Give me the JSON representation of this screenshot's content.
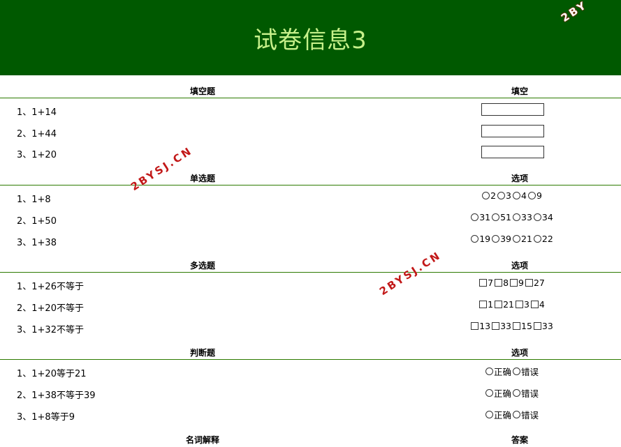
{
  "page": {
    "title": "试卷信息3"
  },
  "watermark": {
    "text": "2BYSJ.CN",
    "corner_text": "2BY"
  },
  "sections": [
    {
      "id": "fill",
      "head_left": "填空题",
      "head_right": "填空",
      "rows": [
        {
          "q": "1、1+14"
        },
        {
          "q": "2、1+44"
        },
        {
          "q": "3、1+20"
        }
      ]
    },
    {
      "id": "single",
      "head_left": "单选题",
      "head_right": "选项",
      "rows": [
        {
          "q": "1、1+8",
          "opts": [
            "2",
            "3",
            "4",
            "9"
          ]
        },
        {
          "q": "2、1+50",
          "opts": [
            "31",
            "51",
            "33",
            "34"
          ]
        },
        {
          "q": "3、1+38",
          "opts": [
            "19",
            "39",
            "21",
            "22"
          ]
        }
      ]
    },
    {
      "id": "multi",
      "head_left": "多选题",
      "head_right": "选项",
      "rows": [
        {
          "q": "1、1+26不等于",
          "opts": [
            "7",
            "8",
            "9",
            "27"
          ]
        },
        {
          "q": "2、1+20不等于",
          "opts": [
            "1",
            "21",
            "3",
            "4"
          ]
        },
        {
          "q": "3、1+32不等于",
          "opts": [
            "13",
            "33",
            "15",
            "33"
          ]
        }
      ]
    },
    {
      "id": "judge",
      "head_left": "判断题",
      "head_right": "选项",
      "rows": [
        {
          "q": "1、1+20等于21",
          "opts": [
            "正确",
            "错误"
          ]
        },
        {
          "q": "2、1+38不等于39",
          "opts": [
            "正确",
            "错误"
          ]
        },
        {
          "q": "3、1+8等于9",
          "opts": [
            "正确",
            "错误"
          ]
        }
      ]
    },
    {
      "id": "term",
      "head_left": "名词解释",
      "head_right": "答案",
      "rows": []
    }
  ]
}
